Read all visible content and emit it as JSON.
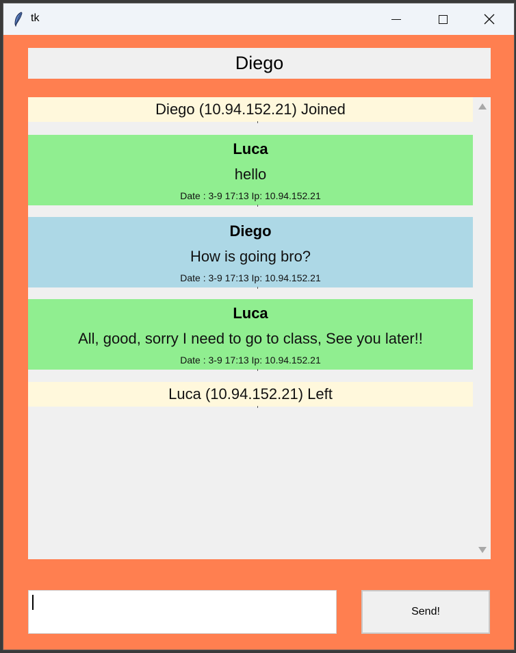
{
  "window": {
    "title": "tk"
  },
  "header": {
    "username": "Diego"
  },
  "messages": [
    {
      "kind": "notice",
      "text": "Diego (10.94.152.21) Joined"
    },
    {
      "kind": "message",
      "color": "#90ee90",
      "sender": "Luca",
      "text": "hello",
      "meta": "Date : 3-9 17:13 Ip: 10.94.152.21"
    },
    {
      "kind": "message",
      "color": "#add8e6",
      "sender": "Diego",
      "text": "How is going bro?",
      "meta": "Date : 3-9 17:13 Ip: 10.94.152.21"
    },
    {
      "kind": "message",
      "color": "#90ee90",
      "sender": "Luca",
      "text": "All, good, sorry I need to go to class, See you later!!",
      "meta": "Date : 3-9 17:13 Ip: 10.94.152.21"
    },
    {
      "kind": "notice",
      "text": "Luca (10.94.152.21) Left"
    }
  ],
  "input": {
    "value": ""
  },
  "send": {
    "label": "Send!"
  },
  "colors": {
    "background": "#ff7f50",
    "notice": "#fff8dc",
    "self_bubble": "#add8e6",
    "other_bubble": "#90ee90"
  }
}
